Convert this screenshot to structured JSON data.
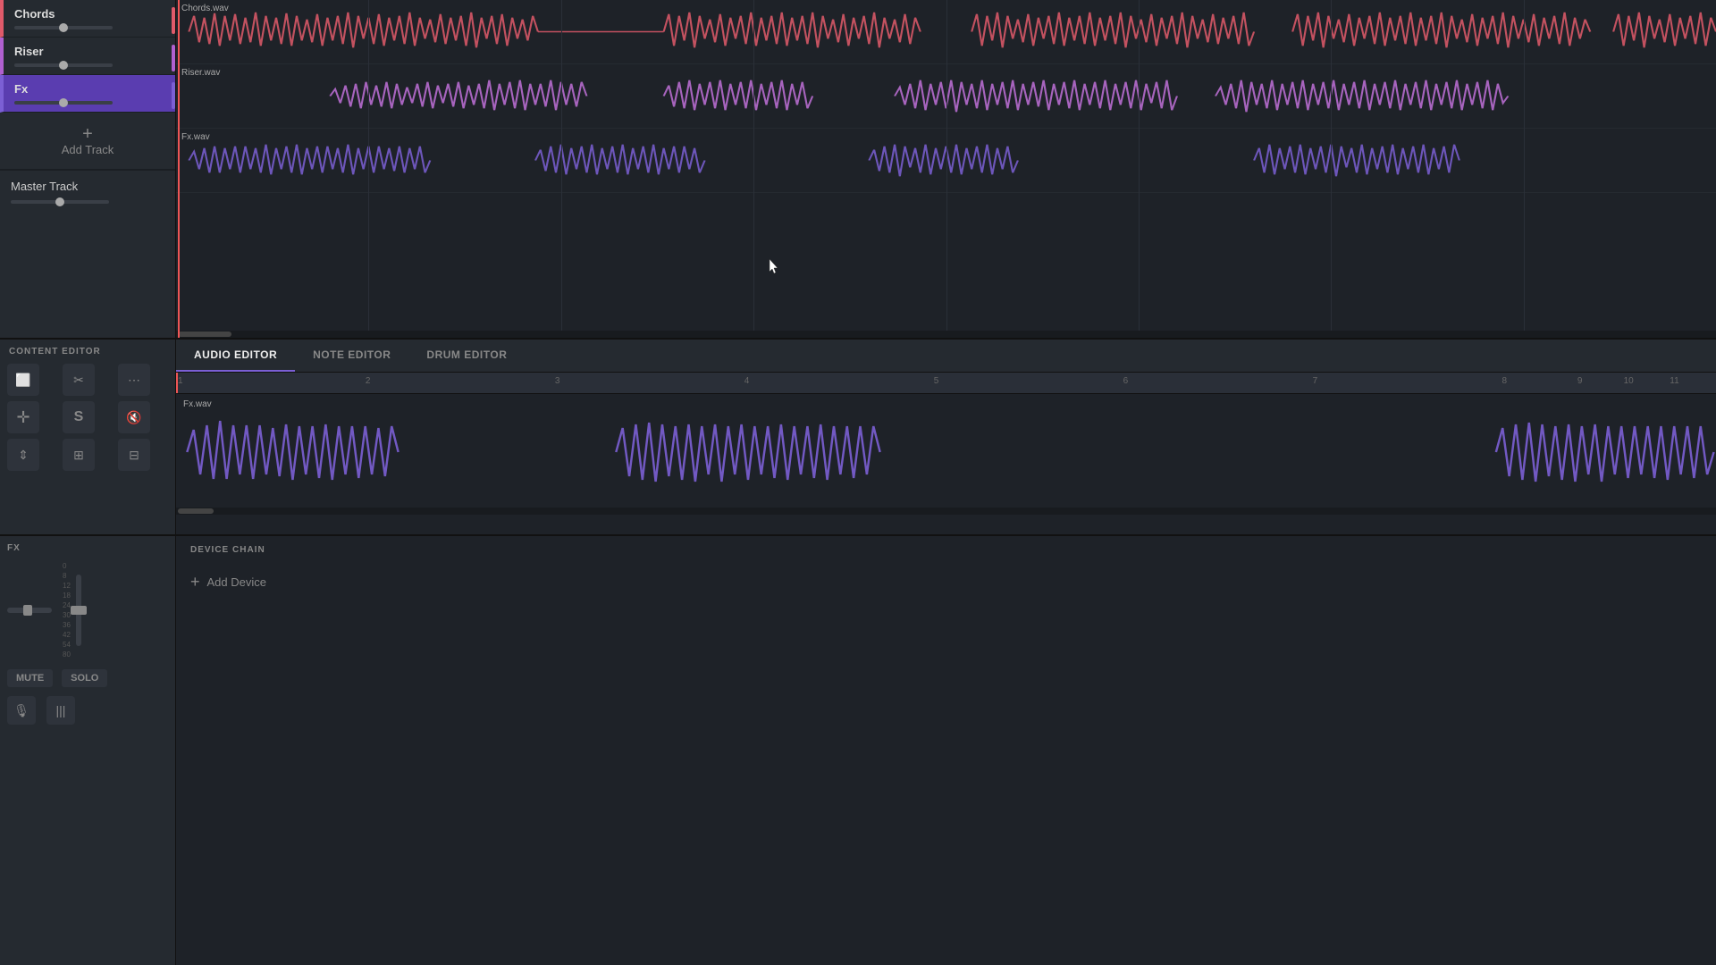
{
  "tracks": [
    {
      "id": "chords",
      "label": "Chords",
      "file": "Chords.wav",
      "color": "#e05a6a",
      "colorBar": "#e05a6a",
      "selected": false,
      "volumePos": 55
    },
    {
      "id": "riser",
      "label": "Riser",
      "file": "Riser.wav",
      "color": "#b060d0",
      "colorBar": "#b060d0",
      "selected": false,
      "volumePos": 55
    },
    {
      "id": "fx",
      "label": "Fx",
      "file": "Fx.wav",
      "color": "#7b5fd4",
      "colorBar": "#7b5fd4",
      "selected": true,
      "volumePos": 55
    }
  ],
  "addTrackLabel": "Add Track",
  "masterTrackLabel": "Master Track",
  "contentEditorLabel": "CONTENT EDITOR",
  "editorTabs": [
    {
      "id": "audio",
      "label": "AUDIO EDITOR",
      "active": true
    },
    {
      "id": "note",
      "label": "NOTE EDITOR",
      "active": false
    },
    {
      "id": "drum",
      "label": "DRUM EDITOR",
      "active": false
    }
  ],
  "audioEditorFile": "Fx.wav",
  "rulerMarks": [
    "2",
    "3",
    "4",
    "5",
    "6",
    "7",
    "8",
    "9",
    "10",
    "11"
  ],
  "fxLabel": "FX",
  "deviceChainLabel": "DEVICE CHAIN",
  "addDeviceLabel": "Add Device",
  "muteLabel": "MUTE",
  "soloLabel": "SOLO",
  "tools": [
    {
      "name": "select-tool",
      "icon": "⬜"
    },
    {
      "name": "cut-tool",
      "icon": "✂"
    },
    {
      "name": "crop-tool",
      "icon": "⋯"
    },
    {
      "name": "move-tool",
      "icon": "✛"
    },
    {
      "name": "stretch-tool",
      "icon": "S"
    },
    {
      "name": "mute-tool",
      "icon": "🔇"
    },
    {
      "name": "align-tool",
      "icon": "⇕"
    },
    {
      "name": "group-tool",
      "icon": "⊞"
    },
    {
      "name": "ungroup-tool",
      "icon": "⊟"
    }
  ],
  "meterLabels": [
    "0",
    "8",
    "12",
    "18",
    "24",
    "30",
    "36",
    "42",
    "54",
    "80"
  ]
}
